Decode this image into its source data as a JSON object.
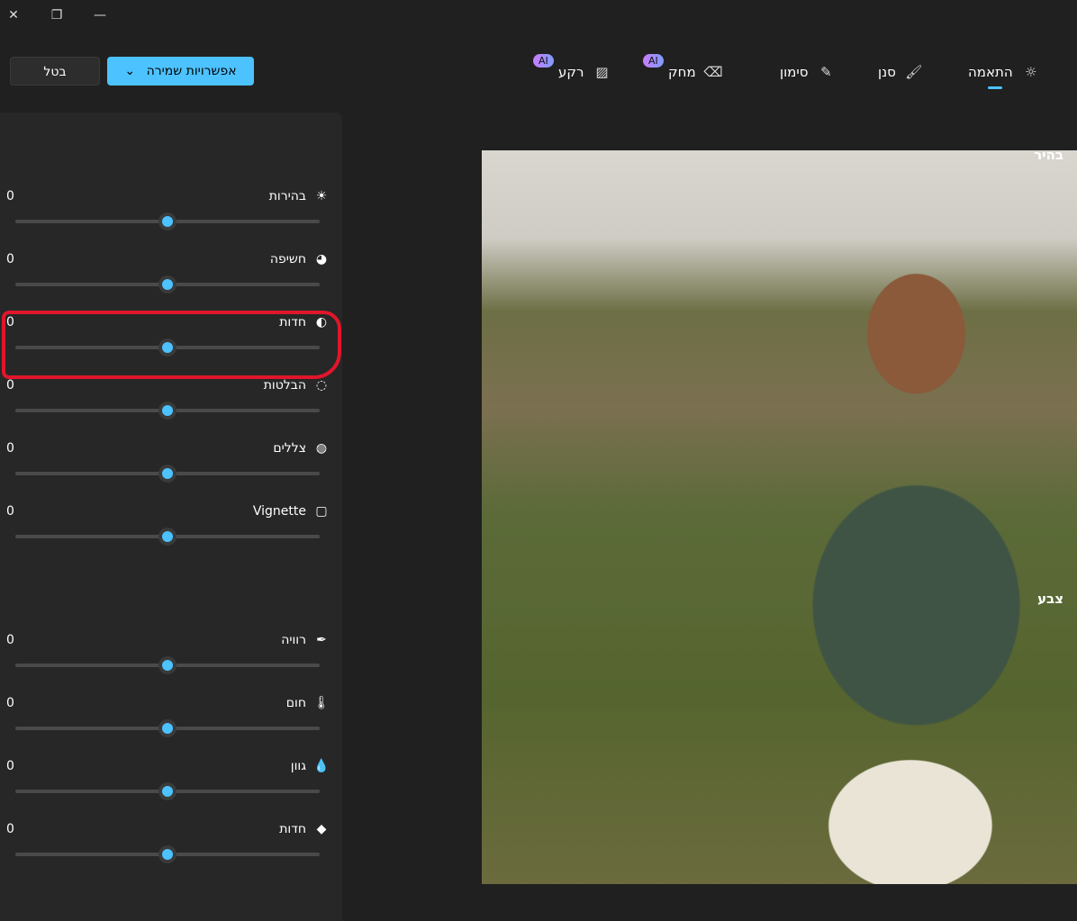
{
  "window": {
    "close": "✕",
    "restore": "❐",
    "minimize": "—"
  },
  "toolbar": {
    "cancel_label": "בטל",
    "save_options_label": "אפשרויות שמירה",
    "chevron": "⌄"
  },
  "tabs": [
    {
      "label": "התאמה",
      "icon": "☼",
      "active": true
    },
    {
      "label": "סנן",
      "icon": "🖌"
    },
    {
      "label": "סימון",
      "icon": "✎"
    },
    {
      "label": "מחק",
      "icon": "⌫",
      "badge": "AI"
    },
    {
      "label": "רקע",
      "icon": "▨",
      "badge": "AI"
    }
  ],
  "panel": {
    "light_heading": "בהיר",
    "light": [
      {
        "label": "בהירות",
        "icon": "☀",
        "value": "0",
        "level": 0.5
      },
      {
        "label": "חשיפה",
        "icon": "◕",
        "value": "0",
        "level": 0.5
      },
      {
        "label": "חדות",
        "icon": "◐",
        "value": "0",
        "level": 0.5
      },
      {
        "label": "הבלטות",
        "icon": "◌",
        "value": "0",
        "level": 0.5
      },
      {
        "label": "צללים",
        "icon": "◍",
        "value": "0",
        "level": 0.5
      },
      {
        "label": "Vignette",
        "icon": "▢",
        "value": "0",
        "level": 0.5
      }
    ],
    "color_heading": "צבע",
    "color": [
      {
        "label": "רוויה",
        "icon": "✒",
        "value": "0",
        "level": 0.5
      },
      {
        "label": "חום",
        "icon": "🌡",
        "value": "0",
        "level": 0.5
      },
      {
        "label": "גוון",
        "icon": "💧",
        "value": "0",
        "level": 0.5
      },
      {
        "label": "חדות",
        "icon": "◆",
        "value": "0",
        "level": 0.5
      }
    ]
  },
  "colors": {
    "accent": "#4cc2ff",
    "annotation": "#e0162b"
  }
}
